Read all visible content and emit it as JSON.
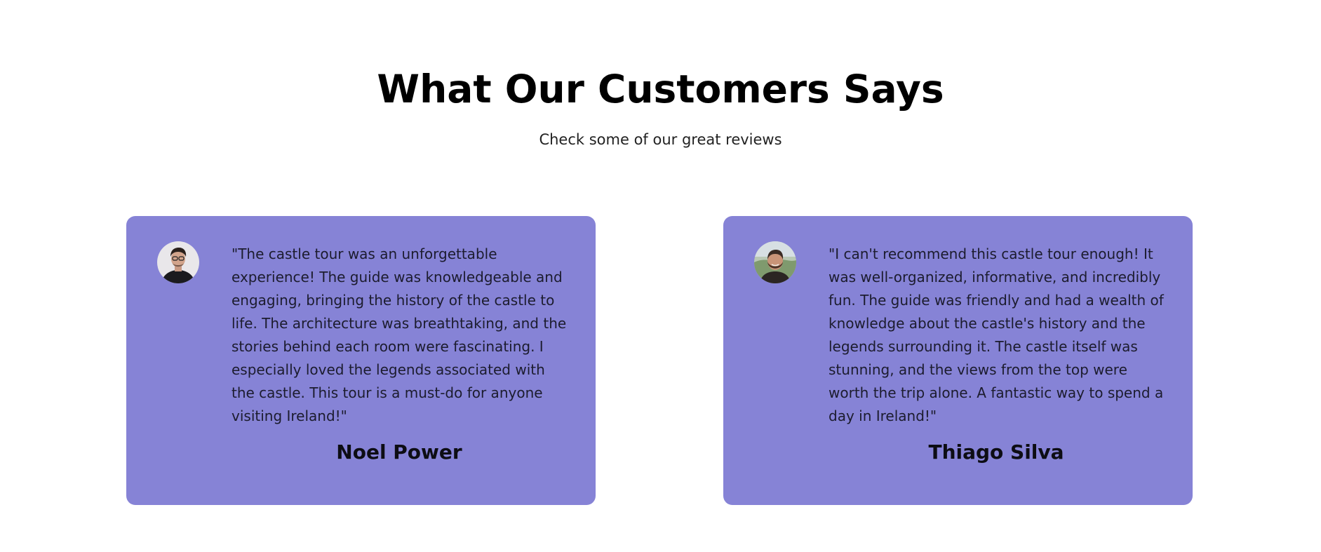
{
  "header": {
    "title": "What Our Customers Says",
    "subtitle": "Check some of our great reviews"
  },
  "colors": {
    "card_background": "#8683d6",
    "title": "#000000"
  },
  "reviews": [
    {
      "quote": "\"The castle tour was an unforgettable experience! The guide was knowledgeable and engaging, bringing the history of the castle to life. The architecture was breathtaking, and the stories behind each room were fascinating. I especially loved the legends associated with the castle. This tour is a must-do for anyone visiting Ireland!\"",
      "author": "Noel Power",
      "avatar_icon": "person-avatar"
    },
    {
      "quote": "\"I can't recommend this castle tour enough! It was well-organized, informative, and incredibly fun. The guide was friendly and had a wealth of knowledge about the castle's history and the legends surrounding it. The castle itself was stunning, and the views from the top were worth the trip alone. A fantastic way to spend a day in Ireland!\"",
      "author": "Thiago Silva",
      "avatar_icon": "person-avatar"
    }
  ]
}
